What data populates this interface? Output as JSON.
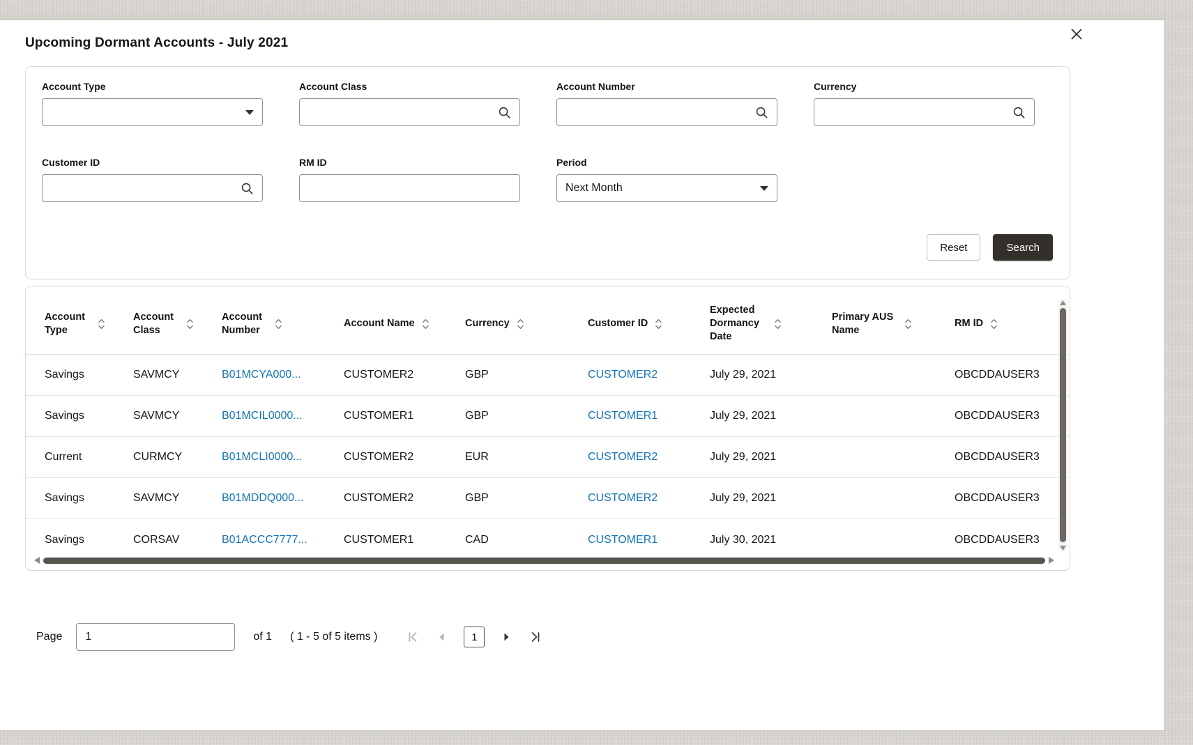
{
  "modal": {
    "title": "Upcoming Dormant Accounts - July 2021"
  },
  "filters": {
    "fields": [
      {
        "label": "Account Type",
        "type": "select",
        "value": ""
      },
      {
        "label": "Account Class",
        "type": "search",
        "value": ""
      },
      {
        "label": "Account Number",
        "type": "search",
        "value": ""
      },
      {
        "label": "Currency",
        "type": "search",
        "value": ""
      },
      {
        "label": "Customer ID",
        "type": "search",
        "value": ""
      },
      {
        "label": "RM ID",
        "type": "text",
        "value": ""
      },
      {
        "label": "Period",
        "type": "select",
        "value": "Next Month"
      }
    ],
    "reset_label": "Reset",
    "search_label": "Search"
  },
  "table": {
    "columns": [
      "Account Type",
      "Account Class",
      "Account Number",
      "Account Name",
      "Currency",
      "Customer ID",
      "Expected Dormancy Date",
      "Primary AUS Name",
      "RM ID"
    ],
    "rows": [
      {
        "account_type": "Savings",
        "account_class": "SAVMCY",
        "account_number": "B01MCYA000...",
        "account_name": "CUSTOMER2",
        "currency": "GBP",
        "customer_id": "CUSTOMER2",
        "expected_dormancy_date": "July 29, 2021",
        "primary_aus_name": "",
        "rm_id": "OBCDDAUSER3"
      },
      {
        "account_type": "Savings",
        "account_class": "SAVMCY",
        "account_number": "B01MCIL0000...",
        "account_name": "CUSTOMER1",
        "currency": "GBP",
        "customer_id": "CUSTOMER1",
        "expected_dormancy_date": "July 29, 2021",
        "primary_aus_name": "",
        "rm_id": "OBCDDAUSER3"
      },
      {
        "account_type": "Current",
        "account_class": "CURMCY",
        "account_number": "B01MCLI0000...",
        "account_name": "CUSTOMER2",
        "currency": "EUR",
        "customer_id": "CUSTOMER2",
        "expected_dormancy_date": "July 29, 2021",
        "primary_aus_name": "",
        "rm_id": "OBCDDAUSER3"
      },
      {
        "account_type": "Savings",
        "account_class": "SAVMCY",
        "account_number": "B01MDDQ000...",
        "account_name": "CUSTOMER2",
        "currency": "GBP",
        "customer_id": "CUSTOMER2",
        "expected_dormancy_date": "July 29, 2021",
        "primary_aus_name": "",
        "rm_id": "OBCDDAUSER3"
      },
      {
        "account_type": "Savings",
        "account_class": "CORSAV",
        "account_number": "B01ACCC7777...",
        "account_name": "CUSTOMER1",
        "currency": "CAD",
        "customer_id": "CUSTOMER1",
        "expected_dormancy_date": "July 30, 2021",
        "primary_aus_name": "",
        "rm_id": "OBCDDAUSER3"
      }
    ]
  },
  "pagination": {
    "page_label": "Page",
    "page_value": "1",
    "of_label": "of 1",
    "items_label": "( 1 - 5 of 5 items )",
    "current_page": "1"
  },
  "colors": {
    "link": "#1273B5",
    "primary_button_bg": "#33302C",
    "text": "#161513"
  }
}
